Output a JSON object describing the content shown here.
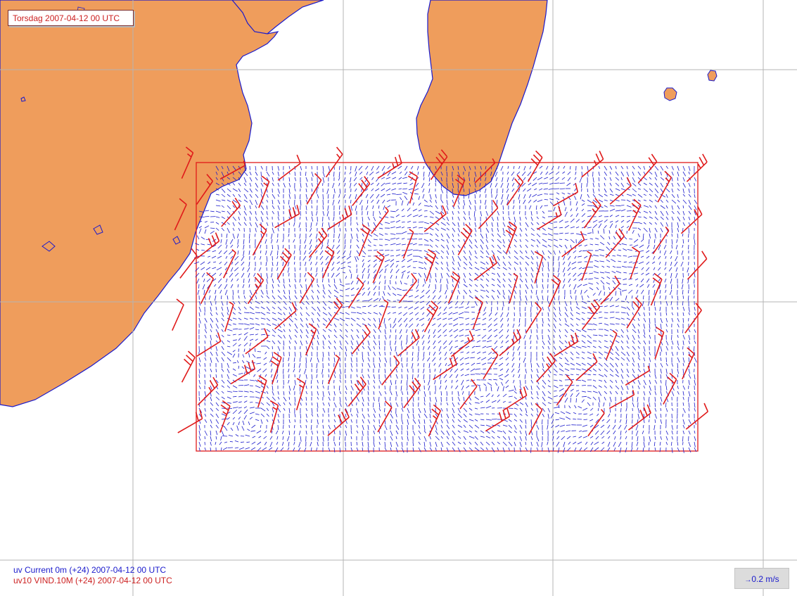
{
  "timestamp_label": "Torsdag 2007-04-12 00 UTC",
  "legend": {
    "line1": "uv Current 0m (+24) 2007-04-12 00 UTC",
    "line2": "uv10 VIND.10M (+24) 2007-04-12 00 UTC"
  },
  "scale": {
    "arrow_glyph": "→",
    "label": "0.2 m/s"
  },
  "colors": {
    "sea": "#ffffff",
    "land": "#ef9d5c",
    "coastline": "#1a1acc",
    "grid": "#b4b4b4",
    "current_vectors": "#1a1acc",
    "wind_barbs": "#e01a1a",
    "domain_box": "#e01a1a"
  }
}
